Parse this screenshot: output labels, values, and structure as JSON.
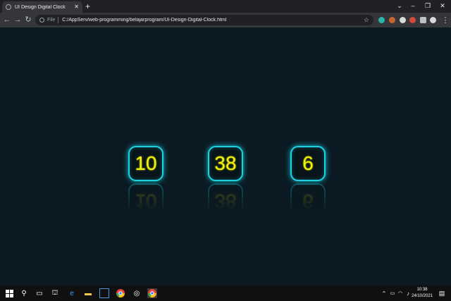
{
  "browser": {
    "tab": {
      "title": "UI Design Digital Clock"
    },
    "address": {
      "scheme_label": "File",
      "url": "C:/AppServ/web-programming/belajarprogram/UI-Design-Digital-Clock.html"
    }
  },
  "clock": {
    "hours": "10",
    "minutes": "38",
    "seconds": "6",
    "digit_color": "#f2f20a",
    "border_color": "#1bd3e3",
    "background_color": "#0b1a22"
  },
  "taskbar": {
    "time": "10:38",
    "date": "24/10/2021"
  }
}
